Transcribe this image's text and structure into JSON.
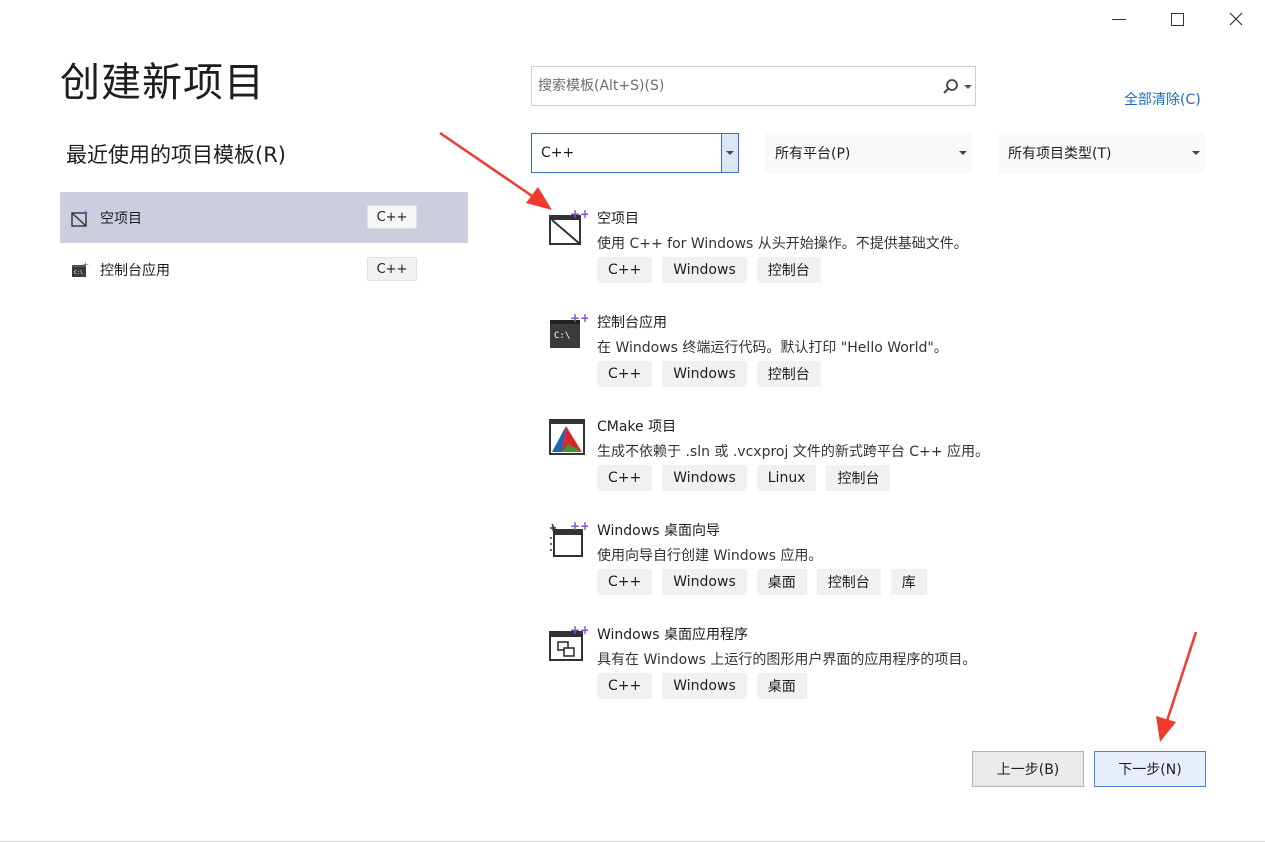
{
  "window": {
    "controls": {
      "minimize": "minimize-icon",
      "maximize": "maximize-icon",
      "close": "close-icon"
    }
  },
  "page": {
    "title": "创建新项目"
  },
  "recent": {
    "title": "最近使用的项目模板(R)",
    "items": [
      {
        "label": "空项目",
        "tag": "C++",
        "icon": "empty-project-icon",
        "selected": true
      },
      {
        "label": "控制台应用",
        "tag": "C++",
        "icon": "console-app-icon",
        "selected": false
      }
    ]
  },
  "search": {
    "placeholder": "搜索模板(Alt+S)(S)",
    "value": "",
    "icon": "search-icon"
  },
  "clear_all": "全部清除(C)",
  "filters": {
    "language": "C++",
    "platform": "所有平台(P)",
    "project_type": "所有项目类型(T)"
  },
  "templates": [
    {
      "name": "空项目",
      "description": "使用 C++ for Windows 从头开始操作。不提供基础文件。",
      "tags": [
        "C++",
        "Windows",
        "控制台"
      ],
      "icon": "empty-project-icon"
    },
    {
      "name": "控制台应用",
      "description": "在 Windows 终端运行代码。默认打印 \"Hello World\"。",
      "tags": [
        "C++",
        "Windows",
        "控制台"
      ],
      "icon": "console-app-icon"
    },
    {
      "name": "CMake 项目",
      "description": "生成不依赖于 .sln 或 .vcxproj 文件的新式跨平台 C++ 应用。",
      "tags": [
        "C++",
        "Windows",
        "Linux",
        "控制台"
      ],
      "icon": "cmake-icon"
    },
    {
      "name": "Windows 桌面向导",
      "description": "使用向导自行创建 Windows 应用。",
      "tags": [
        "C++",
        "Windows",
        "桌面",
        "控制台",
        "库"
      ],
      "icon": "desktop-wizard-icon"
    },
    {
      "name": "Windows 桌面应用程序",
      "description": "具有在 Windows 上运行的图形用户界面的应用程序的项目。",
      "tags": [
        "C++",
        "Windows",
        "桌面"
      ],
      "icon": "desktop-app-icon"
    }
  ],
  "buttons": {
    "back": "上一步(B)",
    "next": "下一步(N)"
  },
  "colors": {
    "accent": "#1a6fc1",
    "selection": "#cbcede",
    "annotation": "#ee3b2c"
  }
}
